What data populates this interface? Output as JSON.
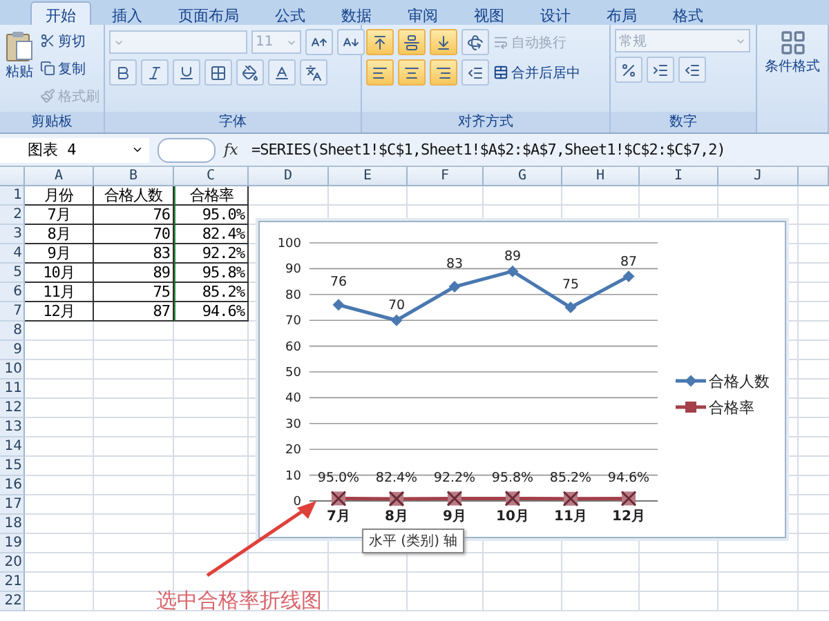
{
  "tabs": [
    {
      "label": "开始",
      "selected": true
    },
    {
      "label": "插入",
      "selected": false
    },
    {
      "label": "页面布局",
      "selected": false
    },
    {
      "label": "公式",
      "selected": false
    },
    {
      "label": "数据",
      "selected": false
    },
    {
      "label": "审阅",
      "selected": false
    },
    {
      "label": "视图",
      "selected": false
    },
    {
      "label": "设计",
      "selected": false
    },
    {
      "label": "布局",
      "selected": false
    },
    {
      "label": "格式",
      "selected": false
    }
  ],
  "ribbon": {
    "clipboard": {
      "paste": "粘贴",
      "group_label": "剪贴板",
      "items": [
        {
          "label": "剪切",
          "disabled": false
        },
        {
          "label": "复制",
          "disabled": false
        },
        {
          "label": "格式刷",
          "disabled": true
        }
      ]
    },
    "font": {
      "size": "11",
      "group_label": "字体"
    },
    "alignment": {
      "group_label": "对齐方式",
      "buttons": [
        {
          "pressed": true
        },
        {
          "pressed": true
        },
        {
          "pressed": true
        },
        {
          "pressed": true
        },
        {
          "pressed": true
        },
        {
          "pressed": true
        }
      ],
      "wrap": {
        "label": "自动换行",
        "disabled": true
      },
      "merge": {
        "label": "合并后居中",
        "disabled": false
      }
    },
    "number": {
      "format": "常规",
      "group_label": "数字"
    },
    "styles": {
      "conditional": "条件格式"
    }
  },
  "formula_bar": {
    "name_box": "图表 4",
    "fx": "fx",
    "formula": "=SERIES(Sheet1!$C$1,Sheet1!$A$2:$A$7,Sheet1!$C$2:$C$7,2)"
  },
  "sheet": {
    "columns": [
      "A",
      "B",
      "C",
      "D",
      "E",
      "F",
      "G",
      "H",
      "I",
      "J"
    ],
    "row_numbers": [
      "1",
      "2",
      "3",
      "4",
      "5",
      "6",
      "7",
      "8",
      "9",
      "10",
      "11",
      "12",
      "13",
      "14",
      "15",
      "16",
      "17",
      "18",
      "19",
      "20",
      "21",
      "22"
    ],
    "cells": [
      [
        "月份",
        "合格人数",
        "合格率"
      ],
      [
        "7月",
        "76",
        "95.0%"
      ],
      [
        "8月",
        "70",
        "82.4%"
      ],
      [
        "9月",
        "83",
        "92.2%"
      ],
      [
        "10月",
        "89",
        "95.8%"
      ],
      [
        "11月",
        "75",
        "85.2%"
      ],
      [
        "12月",
        "87",
        "94.6%"
      ]
    ]
  },
  "chart": {
    "chart_data": {
      "type": "line",
      "categories": [
        "7月",
        "8月",
        "9月",
        "10月",
        "11月",
        "12月"
      ],
      "ylim": [
        0,
        100
      ],
      "yticks": [
        0,
        10,
        20,
        30,
        40,
        50,
        60,
        70,
        80,
        90,
        100
      ],
      "data_labels": true,
      "grid": {
        "y": true
      },
      "legend": true,
      "series": [
        {
          "name": "合格人数",
          "color": "#4a78b0",
          "marker": "diamond",
          "values": [
            76,
            70,
            83,
            89,
            75,
            87
          ],
          "value_labels": [
            "76",
            "70",
            "83",
            "89",
            "75",
            "87"
          ]
        },
        {
          "name": "合格率",
          "color": "#a3404a",
          "marker": "square",
          "values": [
            0.95,
            0.824,
            0.922,
            0.958,
            0.852,
            0.946
          ],
          "value_labels": [
            "95.0%",
            "82.4%",
            "92.2%",
            "95.8%",
            "85.2%",
            "94.6%"
          ]
        }
      ]
    },
    "tooltip": "水平 (类别) 轴"
  },
  "annotation": "选中合格率折线图"
}
